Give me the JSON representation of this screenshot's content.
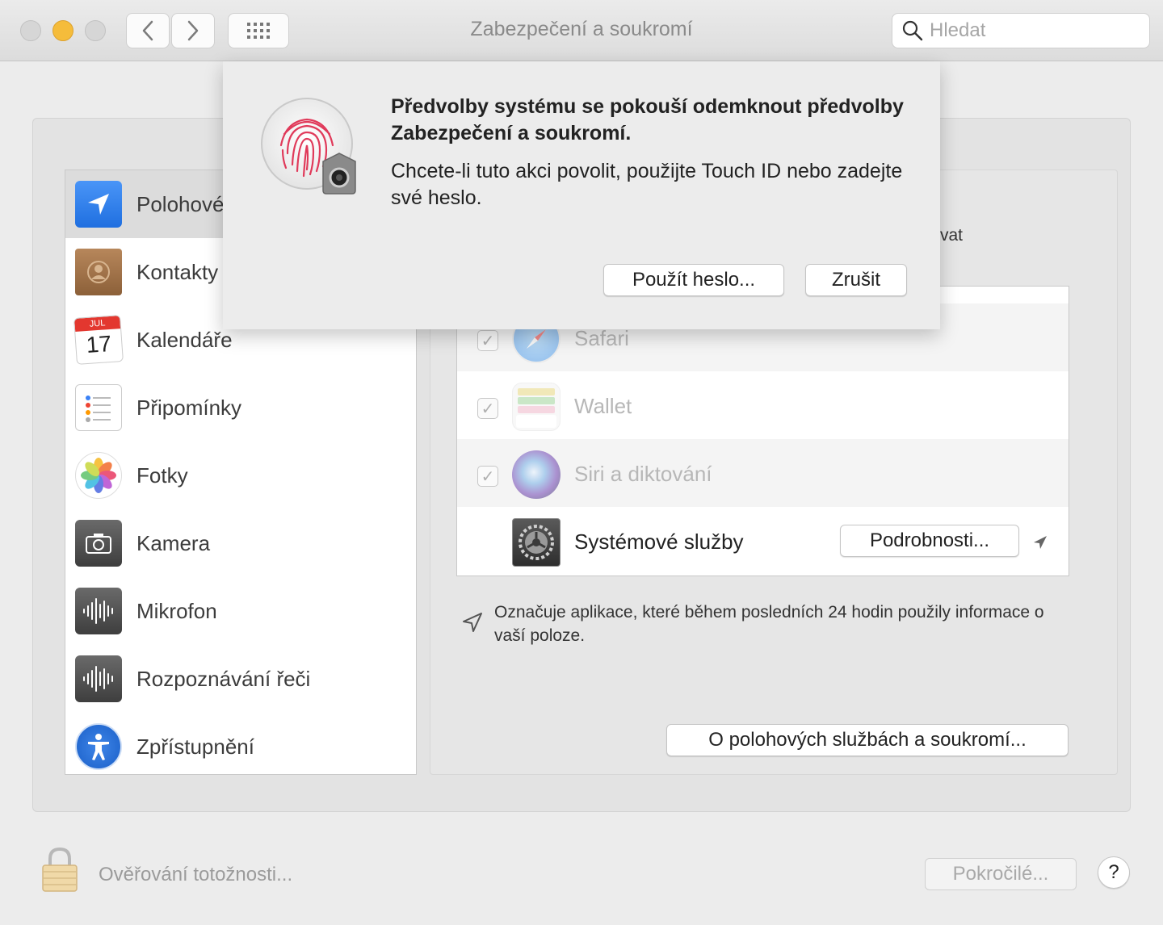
{
  "window": {
    "title": "Zabezpečení a soukromí",
    "search_placeholder": "Hledat"
  },
  "sidebar": {
    "items": [
      {
        "label": "Polohové",
        "icon": "location-arrow-icon",
        "selected": true
      },
      {
        "label": "Kontakty",
        "icon": "contacts-book-icon"
      },
      {
        "label": "Kalendáře",
        "icon": "calendar-icon",
        "icon_month": "JUL",
        "icon_day": "17"
      },
      {
        "label": "Připomínky",
        "icon": "reminders-icon"
      },
      {
        "label": "Fotky",
        "icon": "photos-icon"
      },
      {
        "label": "Kamera",
        "icon": "camera-icon"
      },
      {
        "label": "Mikrofon",
        "icon": "microphone-icon"
      },
      {
        "label": "Rozpoznávání řeči",
        "icon": "speech-recognition-icon"
      },
      {
        "label": "Zpřístupnění",
        "icon": "accessibility-icon"
      }
    ]
  },
  "right_panel": {
    "partial_text": "vat",
    "apps": [
      {
        "label": "Safari",
        "checked": true,
        "icon": "safari-icon"
      },
      {
        "label": "Wallet",
        "checked": true,
        "icon": "wallet-icon"
      },
      {
        "label": "Siri a diktování",
        "checked": true,
        "icon": "siri-icon"
      },
      {
        "label": "Systémové služby",
        "icon": "system-services-gear-icon",
        "details_button": "Podrobnosti..."
      }
    ],
    "note": "Označuje aplikace, které během posledních 24 hodin použily informace o vaší poloze.",
    "about_button": "O polohových službách a soukromí..."
  },
  "footer": {
    "auth_label": "Ověřování totožnosti...",
    "advanced_button": "Pokročilé...",
    "help_button": "?"
  },
  "dialog": {
    "title": "Předvolby systému se pokouší odemknout předvolby Zabezpečení a soukromí.",
    "message": "Chcete-li tuto akci povolit, použijte Touch ID nebo zadejte své heslo.",
    "use_password_button": "Použít heslo...",
    "cancel_button": "Zrušit"
  },
  "colors": {
    "accent_blue": "#2d7ff0",
    "touchid_red": "#e03a5a",
    "close_yellow": "#f5bc3b"
  }
}
